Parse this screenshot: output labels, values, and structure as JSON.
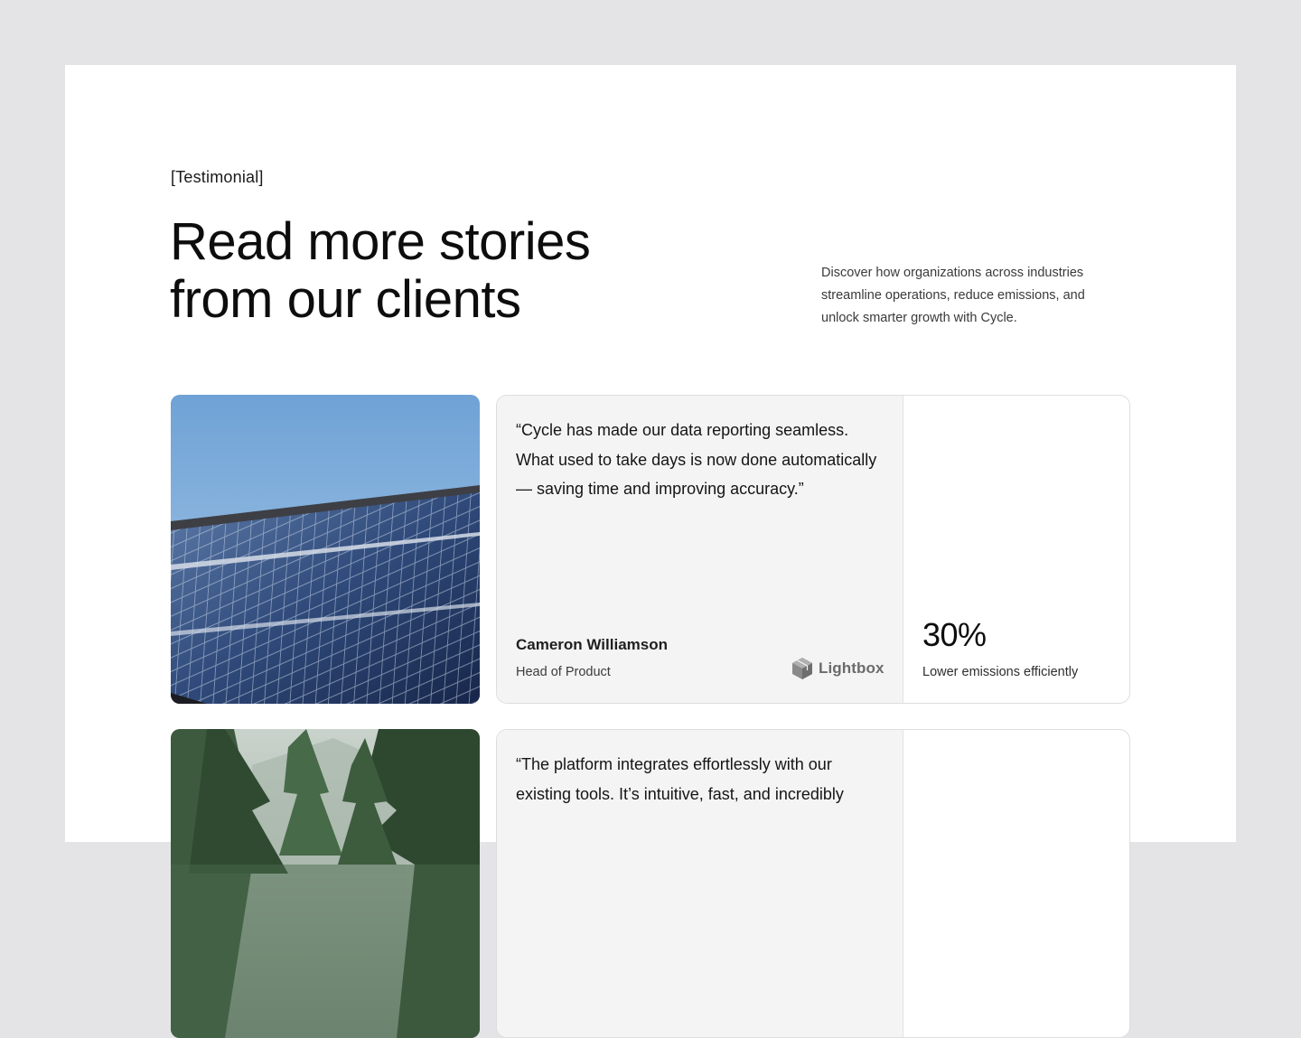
{
  "section": {
    "eyebrow": "[Testimonial]",
    "headline": "Read more stories from our clients",
    "intro": "Discover how organizations across industries streamline operations, reduce emissions, and unlock smarter growth with Cycle."
  },
  "testimonials": [
    {
      "image": "solar-panels-photo",
      "quote": "“Cycle has made our data reporting seamless. What used to take days is now done automatically — saving time and improving accuracy.”",
      "name": "Cameron Williamson",
      "role": "Head of Product",
      "company": "Lightbox",
      "company_icon": "lightbox-cube-icon",
      "stat_value": "30%",
      "stat_label": "Lower emissions efficiently"
    },
    {
      "image": "forest-photo",
      "quote": "“The platform integrates effortlessly with our existing tools. It’s intuitive, fast, and incredibly"
    }
  ],
  "colors": {
    "page_background": "#e4e4e7",
    "surface": "#ffffff",
    "quote_panel": "#f4f4f4",
    "text_primary": "#111111",
    "text_muted": "#6b6b6b"
  }
}
